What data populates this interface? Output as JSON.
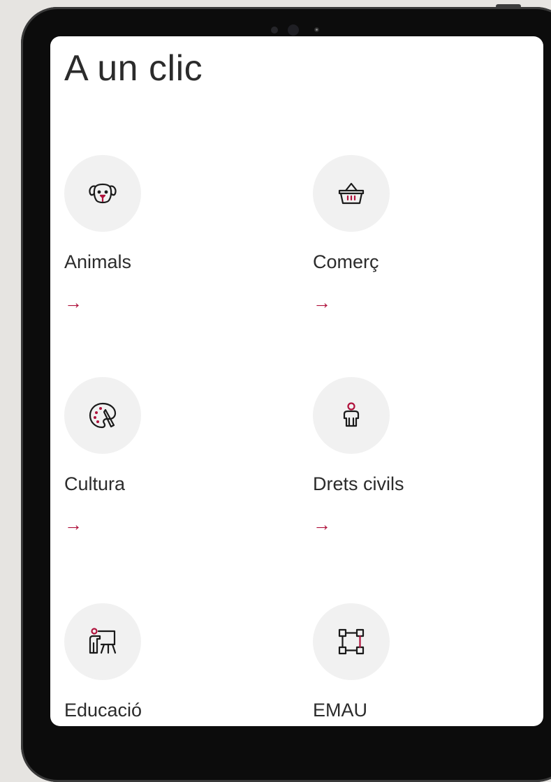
{
  "page": {
    "title": "A un clic"
  },
  "colors": {
    "accent": "#b0123c",
    "icon_bg": "#f1f1f1",
    "text": "#2b2b2b"
  },
  "tiles": [
    {
      "label": "Animals",
      "arrow": "→",
      "icon": "dog-icon"
    },
    {
      "label": "Comerç",
      "arrow": "→",
      "icon": "basket-icon"
    },
    {
      "label": "Cultura",
      "arrow": "→",
      "icon": "palette-icon"
    },
    {
      "label": "Drets civils",
      "arrow": "→",
      "icon": "person-icon"
    },
    {
      "label": "Educació",
      "icon": "teacher-board-icon"
    },
    {
      "label": "EMAU",
      "icon": "network-nodes-icon"
    }
  ]
}
